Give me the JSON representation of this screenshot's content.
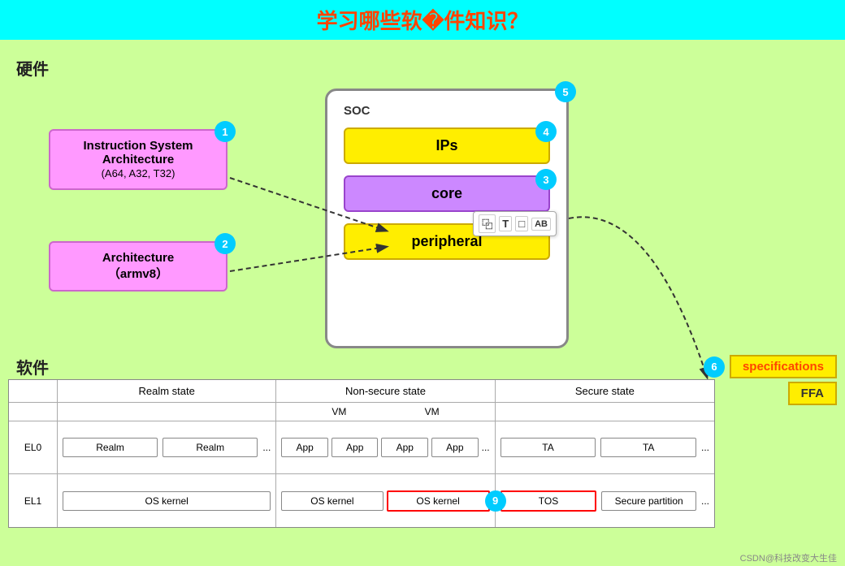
{
  "title": "学习哪些软�件知识？",
  "hardware_label": "硬件",
  "software_label": "软件",
  "isa_box": {
    "line1": "Instruction System",
    "line2": "Architecture",
    "line3": "(A64, A32, T32)",
    "badge": "1"
  },
  "arch_box": {
    "line1": "Architecture",
    "line2": "（armv8）",
    "badge": "2"
  },
  "soc": {
    "label": "SOC",
    "badge": "5",
    "ips": {
      "text": "IPs",
      "badge": "4"
    },
    "core": {
      "text": "core",
      "badge": "3"
    },
    "peripheral": {
      "text": "peripheral"
    }
  },
  "toolbar": {
    "icons": [
      "⿻",
      "T",
      "□",
      "AB"
    ]
  },
  "specifications": {
    "badge": "6",
    "spec_label": "specifications",
    "ffa_label": "FFA"
  },
  "software_diagram": {
    "realm_state": "Realm state",
    "nonsecure_state": "Non-secure state",
    "secure_state": "Secure state",
    "vm": "VM",
    "el0": "EL0",
    "el1": "EL1",
    "realm": "Realm",
    "app": "App",
    "ta": "TA",
    "os_kernel": "OS kernel",
    "tos": "TOS",
    "secure_partition": "Secure partition",
    "ellipsis": "...",
    "badge9": "9"
  },
  "watermark": "CSDN@科技改变大生佳"
}
